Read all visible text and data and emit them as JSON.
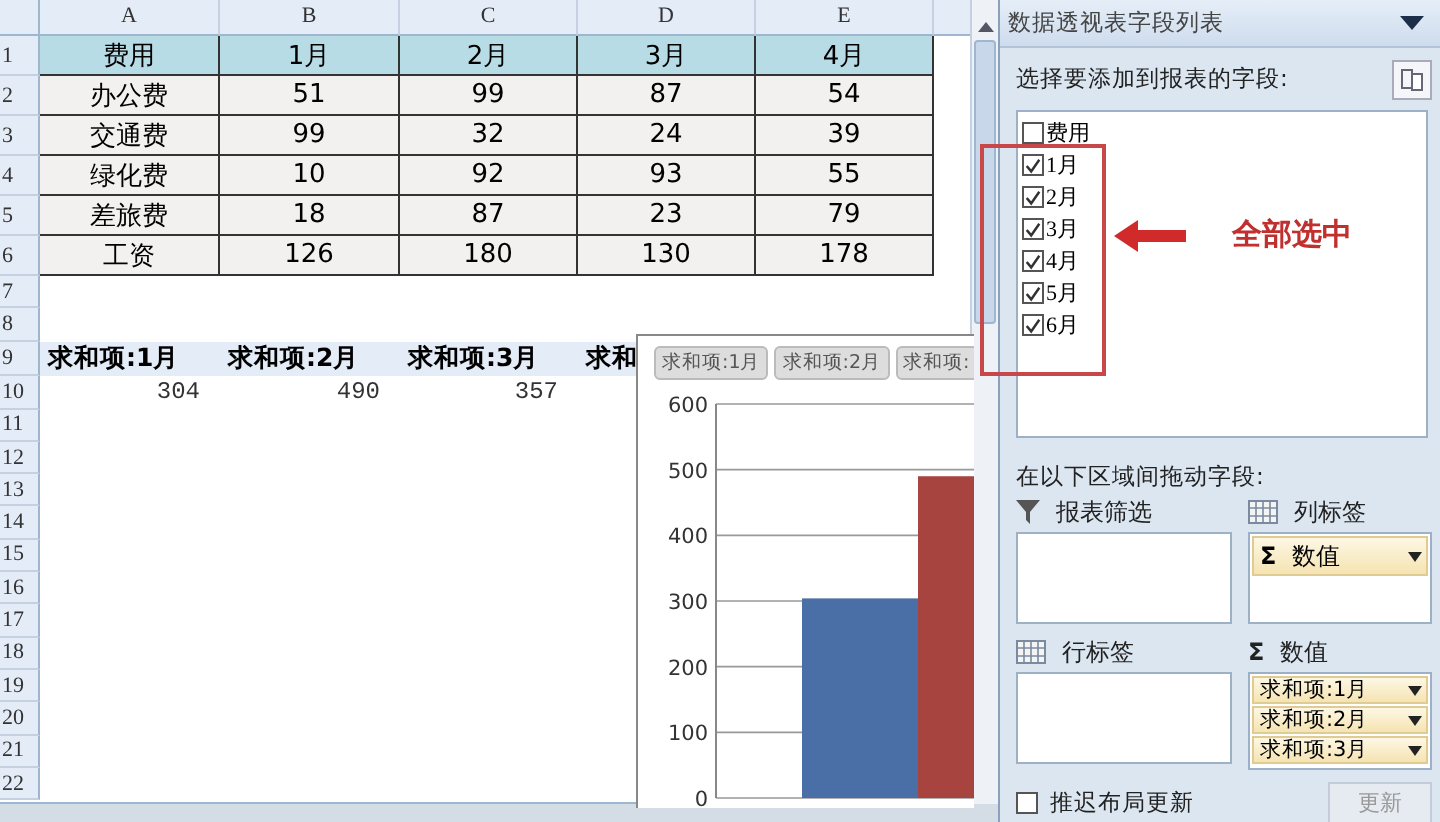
{
  "sheet": {
    "columns": [
      "A",
      "B",
      "C",
      "D",
      "E"
    ],
    "rows": [
      {
        "number": "1",
        "kind": "header",
        "cells": [
          "费用",
          "1月",
          "2月",
          "3月",
          "4月"
        ]
      },
      {
        "number": "2",
        "kind": "data",
        "cells": [
          "办公费",
          "51",
          "99",
          "87",
          "54"
        ]
      },
      {
        "number": "3",
        "kind": "data",
        "cells": [
          "交通费",
          "99",
          "32",
          "24",
          "39"
        ]
      },
      {
        "number": "4",
        "kind": "data",
        "cells": [
          "绿化费",
          "10",
          "92",
          "93",
          "55"
        ]
      },
      {
        "number": "5",
        "kind": "data",
        "cells": [
          "差旅费",
          "18",
          "87",
          "23",
          "79"
        ]
      },
      {
        "number": "6",
        "kind": "data",
        "cells": [
          "工资",
          "126",
          "180",
          "130",
          "178"
        ]
      },
      {
        "number": "7",
        "kind": "empty"
      },
      {
        "number": "8",
        "kind": "empty"
      },
      {
        "number": "9",
        "kind": "pivot_header",
        "cells": [
          "求和项:1月",
          "求和项:2月",
          "求和项:3月",
          "求和"
        ]
      },
      {
        "number": "10",
        "kind": "pivot_value",
        "cells": [
          "304",
          "490",
          "357"
        ]
      },
      {
        "number": "11",
        "kind": "empty"
      },
      {
        "number": "12",
        "kind": "empty"
      },
      {
        "number": "13",
        "kind": "empty"
      },
      {
        "number": "14",
        "kind": "empty"
      },
      {
        "number": "15",
        "kind": "empty"
      },
      {
        "number": "16",
        "kind": "empty"
      },
      {
        "number": "17",
        "kind": "empty"
      },
      {
        "number": "18",
        "kind": "empty"
      },
      {
        "number": "19",
        "kind": "empty"
      },
      {
        "number": "20",
        "kind": "empty"
      },
      {
        "number": "21",
        "kind": "empty"
      },
      {
        "number": "22",
        "kind": "empty"
      }
    ]
  },
  "chart": {
    "more_tabs": [
      "求和项:"
    ],
    "chart_data": {
      "type": "bar",
      "grid": true,
      "yticks": [
        0,
        100,
        200,
        300,
        400,
        500,
        600
      ],
      "ylim": [
        0,
        600
      ],
      "series": [
        {
          "name": "求和项:1月",
          "color": "#4a6ea6",
          "values": [
            304
          ]
        },
        {
          "name": "求和项:2月",
          "color": "#a84440",
          "values": [
            490
          ]
        }
      ]
    }
  },
  "field_list": {
    "title": "数据透视表字段列表",
    "prompt": "选择要添加到报表的字段:",
    "fields": [
      {
        "label": "费用",
        "checked": false
      },
      {
        "label": "1月",
        "checked": true
      },
      {
        "label": "2月",
        "checked": true
      },
      {
        "label": "3月",
        "checked": true
      },
      {
        "label": "4月",
        "checked": true
      },
      {
        "label": "5月",
        "checked": true
      },
      {
        "label": "6月",
        "checked": true
      }
    ],
    "annotation": "全部选中",
    "areas_prompt": "在以下区域间拖动字段:",
    "areas": [
      {
        "kind": "filter",
        "title": "报表筛选"
      },
      {
        "kind": "columns",
        "title": "列标签",
        "items": [
          {
            "sigma": "Σ",
            "label": "数值"
          }
        ]
      },
      {
        "kind": "rows",
        "title": "行标签"
      },
      {
        "kind": "values",
        "sigma": "Σ",
        "title": "数值",
        "items": [
          {
            "label": "求和项:1月"
          },
          {
            "label": "求和项:2月"
          },
          {
            "label": "求和项:3月"
          }
        ]
      }
    ],
    "defer": {
      "label": "推迟布局更新",
      "checked": false
    },
    "update_button": {
      "label": "更新",
      "disabled": true
    }
  }
}
